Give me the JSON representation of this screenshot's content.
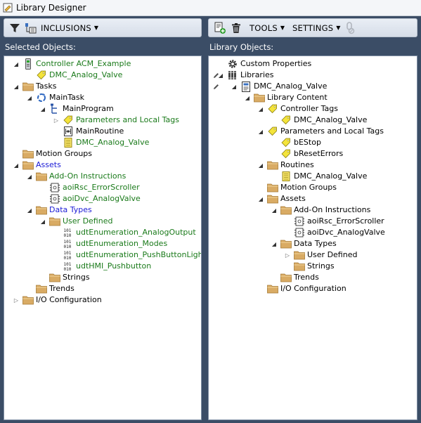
{
  "window": {
    "title": "Library Designer"
  },
  "left": {
    "toolbar": {
      "inclusions_label": "INCLUSIONS"
    },
    "header": "Selected Objects:",
    "rows": [
      {
        "label": "Controller ACM_Example",
        "level": 0,
        "exp": "open",
        "icon": "controller",
        "color": "green"
      },
      {
        "label": "DMC_Analog_Valve",
        "level": 1,
        "exp": "",
        "icon": "tag",
        "color": "green"
      },
      {
        "label": "Tasks",
        "level": 0,
        "exp": "open",
        "icon": "folder",
        "color": "black"
      },
      {
        "label": "MainTask",
        "level": 1,
        "exp": "open",
        "icon": "task",
        "color": "black"
      },
      {
        "label": "MainProgram",
        "level": 2,
        "exp": "open",
        "icon": "program",
        "color": "black"
      },
      {
        "label": "Parameters and Local Tags",
        "level": 3,
        "exp": "closed",
        "icon": "tag",
        "color": "green"
      },
      {
        "label": "MainRoutine",
        "level": 3,
        "exp": "",
        "icon": "routine",
        "color": "black"
      },
      {
        "label": "DMC_Analog_Valve",
        "level": 3,
        "exp": "",
        "icon": "routine-yellow",
        "color": "green"
      },
      {
        "label": "Motion Groups",
        "level": 0,
        "exp": "",
        "icon": "folder",
        "color": "black"
      },
      {
        "label": "Assets",
        "level": 0,
        "exp": "open",
        "icon": "folder",
        "color": "blue"
      },
      {
        "label": "Add-On Instructions",
        "level": 1,
        "exp": "open",
        "icon": "folder",
        "color": "green"
      },
      {
        "label": "aoiRsc_ErrorScroller",
        "level": 2,
        "exp": "",
        "icon": "aoi",
        "color": "green"
      },
      {
        "label": "aoiDvc_AnalogValve",
        "level": 2,
        "exp": "",
        "icon": "aoi",
        "color": "green"
      },
      {
        "label": "Data Types",
        "level": 1,
        "exp": "open",
        "icon": "folder",
        "color": "blue"
      },
      {
        "label": "User Defined",
        "level": 2,
        "exp": "open",
        "icon": "folder",
        "color": "green"
      },
      {
        "label": "udtEnumeration_AnalogOutput",
        "level": 3,
        "exp": "",
        "icon": "udt",
        "color": "green"
      },
      {
        "label": "udtEnumeration_Modes",
        "level": 3,
        "exp": "",
        "icon": "udt",
        "color": "green"
      },
      {
        "label": "udtEnumeration_PushButtonLight",
        "level": 3,
        "exp": "",
        "icon": "udt",
        "color": "green"
      },
      {
        "label": "udtHMI_Pushbutton",
        "level": 3,
        "exp": "",
        "icon": "udt",
        "color": "green"
      },
      {
        "label": "Strings",
        "level": 2,
        "exp": "",
        "icon": "folder",
        "color": "black"
      },
      {
        "label": "Trends",
        "level": 1,
        "exp": "",
        "icon": "folder",
        "color": "black"
      },
      {
        "label": "I/O Configuration",
        "level": 0,
        "exp": "closed",
        "icon": "folder",
        "color": "black"
      }
    ]
  },
  "right": {
    "toolbar": {
      "tools_label": "TOOLS",
      "settings_label": "SETTINGS"
    },
    "header": "Library Objects:",
    "rows": [
      {
        "label": "Custom Properties",
        "level": 0,
        "exp": "",
        "icon": "gear",
        "color": "black",
        "pencil": false
      },
      {
        "label": "Libraries",
        "level": 0,
        "exp": "open",
        "icon": "libraries",
        "color": "black",
        "pencil": true
      },
      {
        "label": "DMC_Analog_Valve",
        "level": 1,
        "exp": "open",
        "icon": "library",
        "color": "black",
        "pencil": true
      },
      {
        "label": "Library Content",
        "level": 2,
        "exp": "open",
        "icon": "folder",
        "color": "black",
        "pencil": false
      },
      {
        "label": "Controller Tags",
        "level": 3,
        "exp": "open",
        "icon": "tag",
        "color": "black",
        "pencil": false
      },
      {
        "label": "DMC_Analog_Valve",
        "level": 4,
        "exp": "",
        "icon": "tag",
        "color": "black",
        "pencil": false
      },
      {
        "label": "Parameters and Local Tags",
        "level": 3,
        "exp": "open",
        "icon": "tag",
        "color": "black",
        "pencil": false
      },
      {
        "label": "bEStop",
        "level": 4,
        "exp": "",
        "icon": "tag",
        "color": "black",
        "pencil": false
      },
      {
        "label": "bResetErrors",
        "level": 4,
        "exp": "",
        "icon": "tag",
        "color": "black",
        "pencil": false
      },
      {
        "label": "Routines",
        "level": 3,
        "exp": "open",
        "icon": "folder",
        "color": "black",
        "pencil": false
      },
      {
        "label": "DMC_Analog_Valve",
        "level": 4,
        "exp": "",
        "icon": "routine-yellow",
        "color": "black",
        "pencil": false
      },
      {
        "label": "Motion Groups",
        "level": 3,
        "exp": "",
        "icon": "folder",
        "color": "black",
        "pencil": false
      },
      {
        "label": "Assets",
        "level": 3,
        "exp": "open",
        "icon": "folder",
        "color": "black",
        "pencil": false
      },
      {
        "label": "Add-On Instructions",
        "level": 4,
        "exp": "open",
        "icon": "folder",
        "color": "black",
        "pencil": false
      },
      {
        "label": "aoiRsc_ErrorScroller",
        "level": 5,
        "exp": "",
        "icon": "aoi",
        "color": "black",
        "pencil": false
      },
      {
        "label": "aoiDvc_AnalogValve",
        "level": 5,
        "exp": "",
        "icon": "aoi",
        "color": "black",
        "pencil": false
      },
      {
        "label": "Data Types",
        "level": 4,
        "exp": "open",
        "icon": "folder",
        "color": "black",
        "pencil": false
      },
      {
        "label": "User Defined",
        "level": 5,
        "exp": "closed",
        "icon": "folder",
        "color": "black",
        "pencil": false
      },
      {
        "label": "Strings",
        "level": 5,
        "exp": "",
        "icon": "folder",
        "color": "black",
        "pencil": false
      },
      {
        "label": "Trends",
        "level": 4,
        "exp": "",
        "icon": "folder",
        "color": "black",
        "pencil": false
      },
      {
        "label": "I/O Configuration",
        "level": 3,
        "exp": "",
        "icon": "folder",
        "color": "black",
        "pencil": false
      }
    ]
  }
}
